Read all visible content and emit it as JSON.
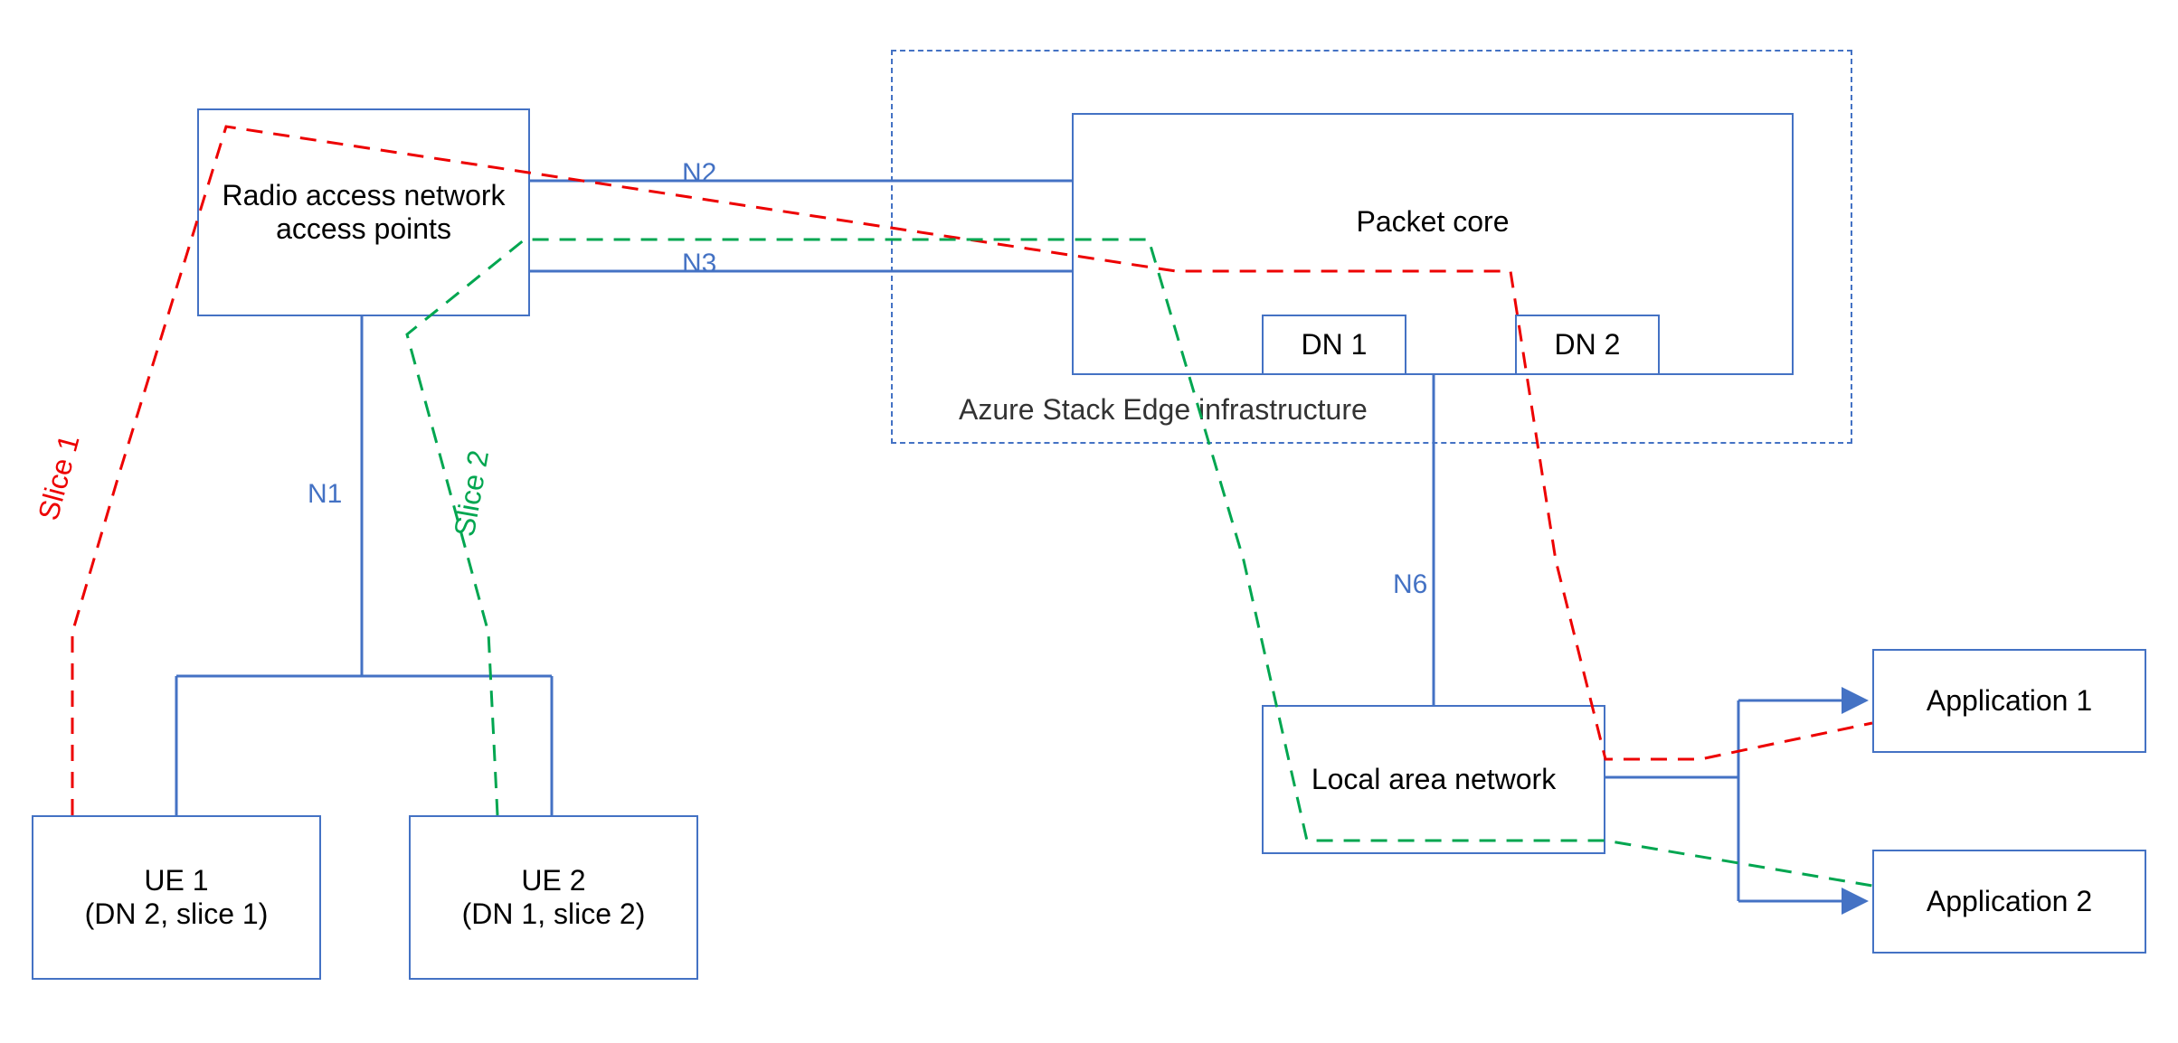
{
  "nodes": {
    "ran": "Radio access network access points",
    "packetCore": "Packet core",
    "dn1": "DN 1",
    "dn2": "DN 2",
    "azureStack": "Azure Stack Edge infrastructure",
    "ue1_line1": "UE 1",
    "ue1_line2": "(DN 2, slice 1)",
    "ue2_line1": "UE 2",
    "ue2_line2": "(DN 1, slice 2)",
    "lan": "Local area network",
    "app1": "Application 1",
    "app2": "Application 2"
  },
  "links": {
    "n1": "N1",
    "n2": "N2",
    "n3": "N3",
    "n6": "N6"
  },
  "slices": {
    "slice1": "Slice 1",
    "slice2": "Slice 2"
  },
  "colors": {
    "boxBorder": "#4472C4",
    "red": "#ED0000",
    "green": "#00A650"
  }
}
